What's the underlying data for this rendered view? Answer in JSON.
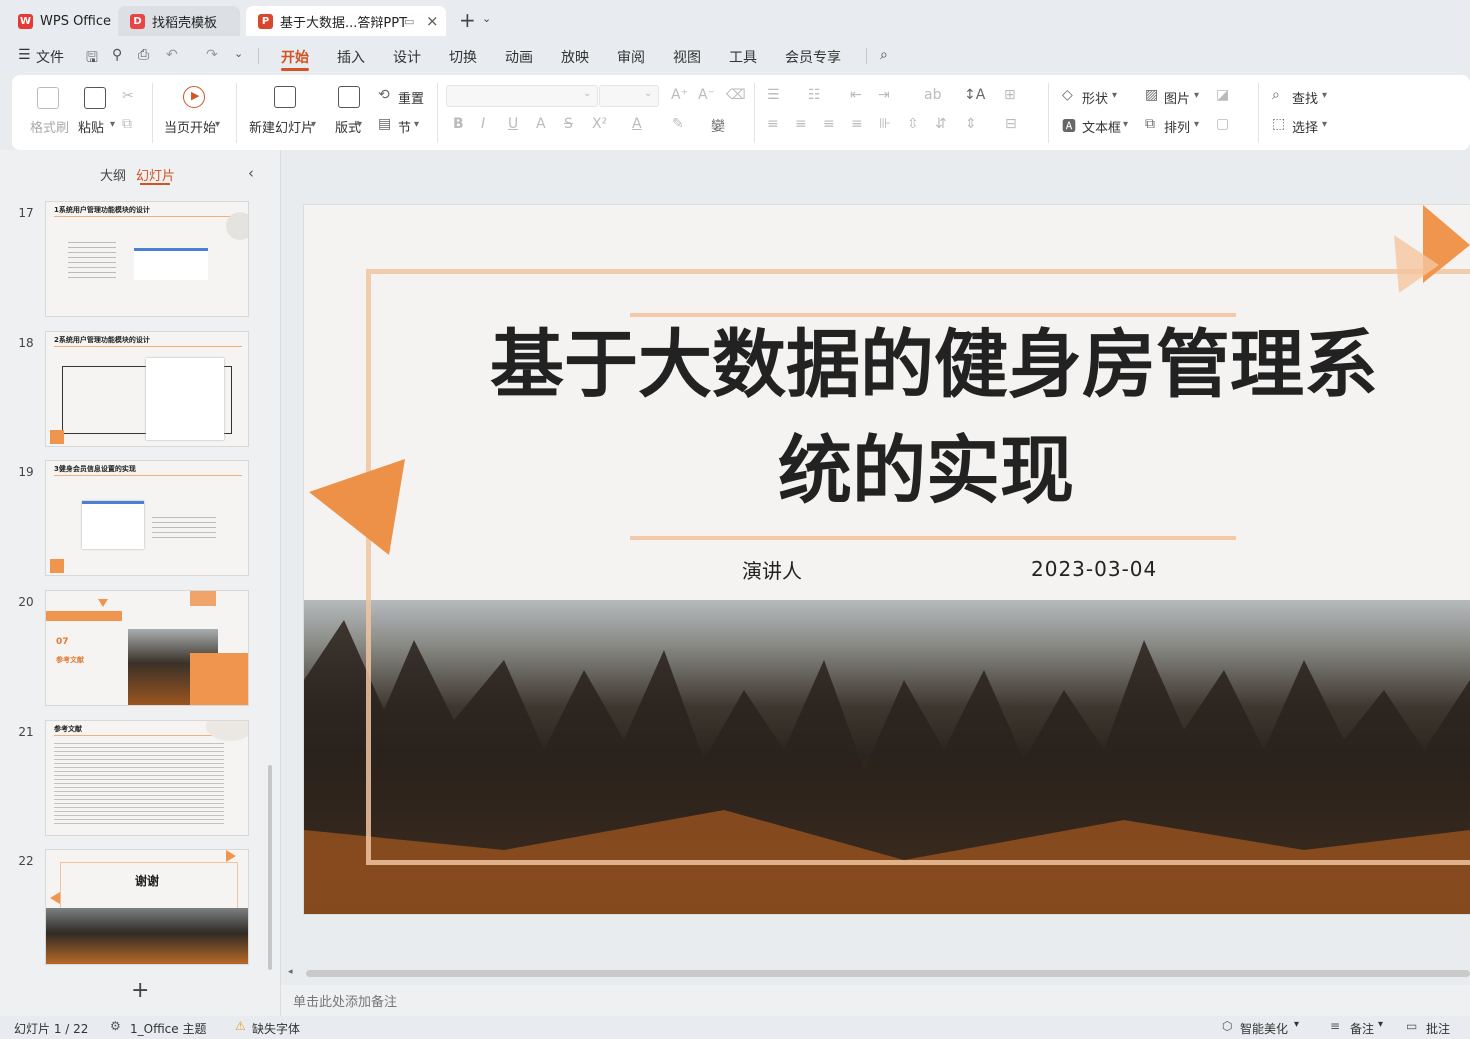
{
  "tabs": [
    {
      "label": "WPS Office",
      "logo": "W"
    },
    {
      "label": "找稻壳模板",
      "logo": "D"
    },
    {
      "label": "基于大数据...答辩PPT",
      "logo": "P"
    }
  ],
  "menu": {
    "file": "文件",
    "items": [
      "开始",
      "插入",
      "设计",
      "切换",
      "动画",
      "放映",
      "审阅",
      "视图",
      "工具",
      "会员专享"
    ],
    "active": "开始"
  },
  "ribbon": {
    "format_painter": "格式刷",
    "paste": "粘贴",
    "from_start": "当页开始",
    "new_slide": "新建幻灯片",
    "layout": "版式",
    "reset": "重置",
    "section": "节",
    "shape": "形状",
    "picture": "图片",
    "textbox": "文本框",
    "arrange": "排列",
    "find": "查找",
    "select": "选择"
  },
  "panel": {
    "outline": "大纲",
    "slides": "幻灯片"
  },
  "thumbs": [
    {
      "num": "17",
      "title": "1系统用户管理功能模块的设计"
    },
    {
      "num": "18",
      "title": "2系统用户管理功能模块的设计"
    },
    {
      "num": "19",
      "title": "3健身会员信息设置的实现"
    },
    {
      "num": "20",
      "title": "07",
      "sub": "参考文献"
    },
    {
      "num": "21",
      "title": "参考文献"
    },
    {
      "num": "22",
      "title": "谢谢"
    }
  ],
  "slide": {
    "title_line1": "基于大数据的健身房管理系",
    "title_line2": "统的实现",
    "presenter": "演讲人",
    "date": "2023-03-04"
  },
  "notes_placeholder": "单击此处添加备注",
  "status": {
    "slide_count": "幻灯片 1 / 22",
    "theme": "1_Office 主题",
    "missing_font": "缺失字体",
    "beautify": "智能美化",
    "notes": "备注",
    "comments": "批注"
  },
  "colors": {
    "accent": "#f0954e",
    "active_tab": "#d35322"
  }
}
